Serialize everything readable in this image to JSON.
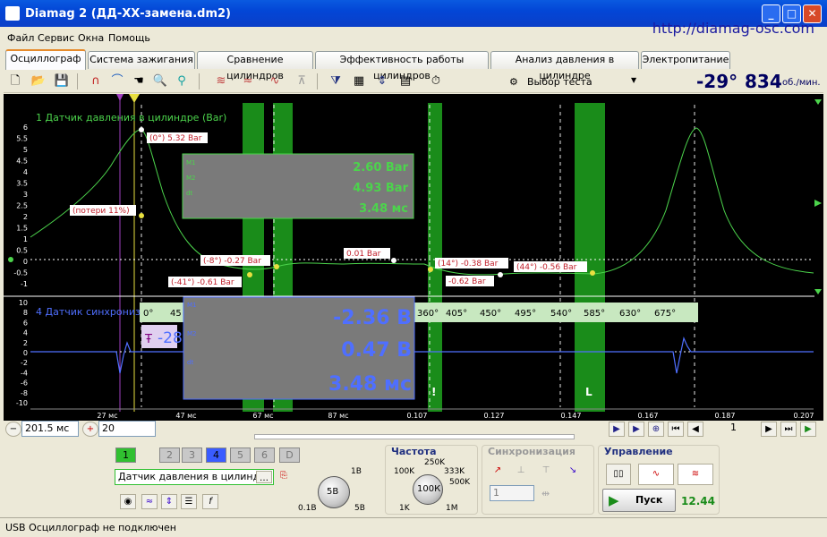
{
  "window": {
    "title": "Diamag 2 (ДД-ХХ-замена.dm2)",
    "min": "_",
    "max": "□",
    "close": "✕"
  },
  "menu": [
    "Файл",
    "Сервис",
    "Окна",
    "Помощь"
  ],
  "url": "http://diamag-osc.com",
  "tabs": [
    "Осциллограф",
    "Система зажигания",
    "Сравнение цилиндров",
    "Эффективность работы цилиндров",
    "Анализ давления в цилиндре",
    "Электропитание"
  ],
  "toolbar": {
    "test_select": "Выбор теста",
    "angle": "-29°",
    "rpm": "834",
    "rpm_unit": "об./мин."
  },
  "channel1": {
    "label": "1 Датчик давления в цилиндре (Bar)",
    "y_ticks": [
      "6",
      "5.5",
      "5",
      "4.5",
      "4",
      "3.5",
      "3",
      "2.5",
      "2",
      "1.5",
      "1",
      "0.5",
      "0",
      "-0.5",
      "-1"
    ],
    "markers": {
      "top": "(0°) 5.32 Bar",
      "loss": "(потери 11%)",
      "m8": "(-8°) -0.27 Bar",
      "m41": "(-41°) -0.61 Bar",
      "mid": "0.01 Bar",
      "m14": "(14°) -0.38 Bar",
      "m14b": "-0.62 Bar",
      "m44": "(44°) -0.56 Bar"
    },
    "measure": {
      "m1_label": "M1",
      "m2_label": "M2",
      "dt_label": "dt",
      "m1": "2.60 Bar",
      "m2": "4.93 Bar",
      "dt": "3.48 мс"
    }
  },
  "channel4": {
    "label": "4 Датчик синхрониз",
    "y_ticks": [
      "10",
      "8",
      "6",
      "4",
      "2",
      "0",
      "-2",
      "-4",
      "-6",
      "-8",
      "-10"
    ],
    "trigger_value": "-28",
    "measure": {
      "m1_label": "M1",
      "m2_label": "M2",
      "dt_label": "dt",
      "m1": "-2.36 В",
      "m2": "0.47 В",
      "dt": "3.48 мс"
    },
    "angle_scale": [
      "0°",
      "45",
      "360°",
      "405°",
      "450°",
      "495°",
      "540°",
      "585°",
      "630°",
      "675°"
    ],
    "zone_labels": [
      "!",
      "L"
    ]
  },
  "time_axis": [
    "27 мс",
    "47 мс",
    "67 мс",
    "87 мс",
    "0.107",
    "0.127",
    "0.147",
    "0.167",
    "0.187",
    "0.207"
  ],
  "controls": {
    "timebase": "201.5 мс",
    "count": "20",
    "page": "1",
    "channels": [
      "1",
      "2",
      "3",
      "4",
      "5",
      "6",
      "D"
    ],
    "channel_name": "Датчик давления в цилиндре",
    "volt_knob": "5В",
    "volt_marks": [
      "1В",
      "0.1В",
      "5В"
    ],
    "freq_title": "Частота",
    "freq_knob": "100К",
    "freq_marks": [
      "250K",
      "100K",
      "333K",
      "500K",
      "1K",
      "1M"
    ],
    "sync_title": "Синхронизация",
    "sync_value": "1",
    "control_title": "Управление",
    "start": "Пуск",
    "counter": "12.44"
  },
  "status": "USB Осциллограф не подключен",
  "colors": {
    "accent": "#0a5ae0",
    "trace1": "#4cd44c",
    "trace4": "#4f6fff",
    "zone": "#1a8c1a",
    "panel": "#7a7a7a"
  }
}
